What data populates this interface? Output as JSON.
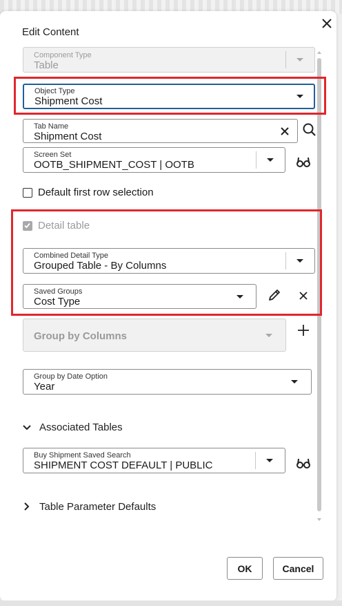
{
  "dialog": {
    "title": "Edit Content",
    "close_icon": "close-icon"
  },
  "form": {
    "component_type": {
      "label": "Component Type",
      "value": "Table"
    },
    "object_type": {
      "label": "Object Type",
      "value": "Shipment Cost"
    },
    "tab_name": {
      "label": "Tab Name",
      "value": "Shipment Cost"
    },
    "screen_set": {
      "label": "Screen Set",
      "value": "OOTB_SHIPMENT_COST | OOTB"
    },
    "default_first_row": {
      "label": "Default first row selection",
      "checked": false
    },
    "detail_table": {
      "label": "Detail table",
      "checked": true
    },
    "combined_detail_type": {
      "label": "Combined Detail Type",
      "value": "Grouped Table - By Columns"
    },
    "saved_groups": {
      "label": "Saved Groups",
      "value": "Cost Type"
    },
    "group_by_columns": {
      "value": "Group by Columns"
    },
    "group_by_date_option": {
      "label": "Group by Date Option",
      "value": "Year"
    }
  },
  "associated_tables": {
    "heading": "Associated Tables",
    "buy_shipment_saved_search": {
      "label": "Buy Shipment Saved Search",
      "value": "SHIPMENT COST DEFAULT | PUBLIC"
    }
  },
  "table_parameter_defaults": {
    "heading": "Table Parameter Defaults"
  },
  "footer": {
    "ok_label": "OK",
    "cancel_label": "Cancel"
  },
  "colors": {
    "highlight": "#e1262c",
    "focus": "#1f5f99"
  }
}
